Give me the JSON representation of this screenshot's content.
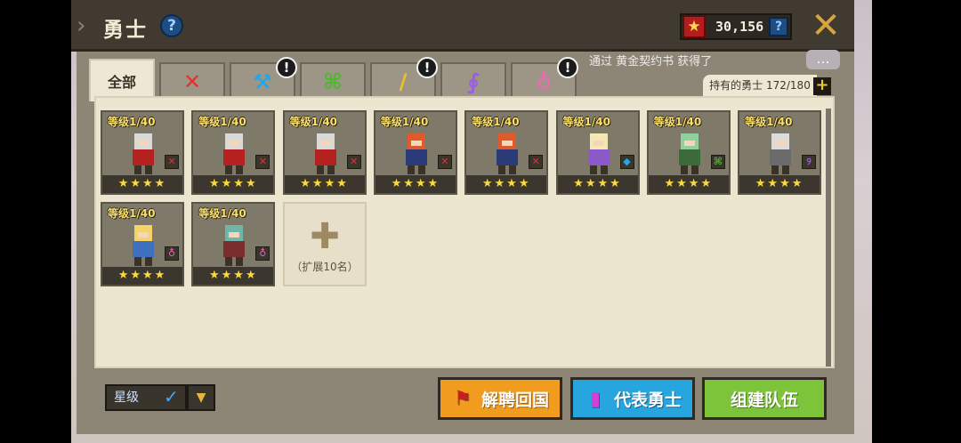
{
  "header": {
    "title": "勇士",
    "help_icon": "?",
    "currency_value": "30,156",
    "currency_help": "?",
    "close_icon": "close-x-icon"
  },
  "tabs": [
    {
      "label": "全部",
      "icon": "",
      "active": true,
      "alert": false
    },
    {
      "label": "",
      "icon": "sword-icon",
      "glyph": "✕",
      "color": "#e0332d",
      "alert": false
    },
    {
      "label": "",
      "icon": "hammer-icon",
      "glyph": "⚒",
      "color": "#27a6e5",
      "alert": true
    },
    {
      "label": "",
      "icon": "bow-icon",
      "glyph": "⌘",
      "color": "#4fb82e",
      "alert": false
    },
    {
      "label": "",
      "icon": "gun-icon",
      "glyph": "/",
      "color": "#f0c02c",
      "alert": true
    },
    {
      "label": "",
      "icon": "staff-icon",
      "glyph": "∮",
      "color": "#9a5fe0",
      "alert": false
    },
    {
      "label": "",
      "icon": "support-icon",
      "glyph": "♁",
      "color": "#f266b8",
      "alert": true
    }
  ],
  "alert_glyph": "!",
  "notice": "通过 黄金契约书 获得了",
  "chat_icon": "…",
  "hero_count": "持有的勇士 172/180",
  "heroes": [
    {
      "level": "等级1/40",
      "stars": "★★★★",
      "class_icon": "sword-icon",
      "class_color": "#e0332d"
    },
    {
      "level": "等级1/40",
      "stars": "★★★★",
      "class_icon": "sword-icon",
      "class_color": "#e0332d"
    },
    {
      "level": "等级1/40",
      "stars": "★★★★",
      "class_icon": "sword-icon",
      "class_color": "#e0332d"
    },
    {
      "level": "等级1/40",
      "stars": "★★★★",
      "class_icon": "sword-icon",
      "class_color": "#e0332d"
    },
    {
      "level": "等级1/40",
      "stars": "★★★★",
      "class_icon": "sword-icon",
      "class_color": "#e0332d"
    },
    {
      "level": "等级1/40",
      "stars": "★★★★",
      "class_icon": "hammer-icon",
      "class_color": "#27a6e5"
    },
    {
      "level": "等级1/40",
      "stars": "★★★★",
      "class_icon": "bow-icon",
      "class_color": "#4fb82e"
    },
    {
      "level": "等级1/40",
      "stars": "★★★★",
      "class_icon": "staff-icon",
      "class_color": "#9a5fe0"
    },
    {
      "level": "等级1/40",
      "stars": "★★★★",
      "class_icon": "support-icon",
      "class_color": "#f266b8"
    },
    {
      "level": "等级1/40",
      "stars": "★★★★",
      "class_icon": "support-icon",
      "class_color": "#f266b8"
    }
  ],
  "expand_slot": {
    "label": "（扩展10名）"
  },
  "sort": {
    "selected": "星级"
  },
  "buttons": {
    "dismiss": "解聘回国",
    "representative": "代表勇士",
    "team": "组建队伍"
  },
  "colors": {
    "dismiss": "#f19b1f",
    "representative": "#26a5df",
    "team": "#7ec43a"
  }
}
